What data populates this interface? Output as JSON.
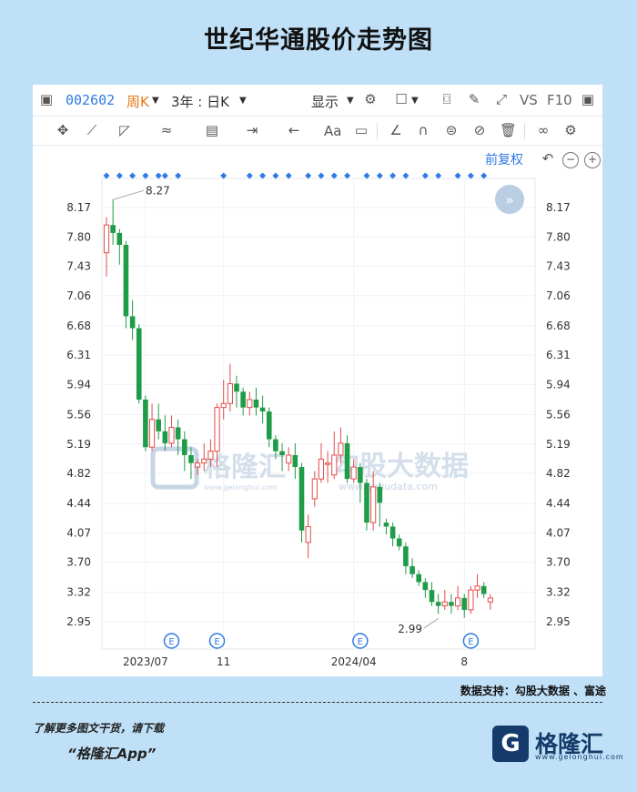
{
  "title": "世纪华通股价走势图",
  "toolbar": {
    "code": "002602",
    "period": "周K",
    "range": "3年 : 日K",
    "display": "显示",
    "vs": "VS",
    "f10": "F10",
    "text_tool": "Aa",
    "adjust": "前复权"
  },
  "credit": "数据支持：勾股大数据 、富途",
  "download_line1": "了解更多图文干货，请下载",
  "download_line2": "“格隆汇App”",
  "logo": {
    "glyph": "G",
    "name": "格隆汇",
    "url": "www.gelonghui.com"
  },
  "watermarks": {
    "left": "格隆汇",
    "left_url": "www.gelonghui.com",
    "right": "勾股大数据",
    "right_url": "www.gogudata.com"
  },
  "chart_data": {
    "type": "candlestick",
    "y_ticks": [
      "8.17",
      "7.80",
      "7.43",
      "7.06",
      "6.68",
      "6.31",
      "5.94",
      "5.56",
      "5.19",
      "4.82",
      "4.44",
      "4.07",
      "3.70",
      "3.32",
      "2.95"
    ],
    "ylim": [
      2.95,
      8.17
    ],
    "x_ticks": [
      {
        "label": "2023/07",
        "index": 6
      },
      {
        "label": "11",
        "index": 18
      },
      {
        "label": "2024/04",
        "index": 38
      },
      {
        "label": "8",
        "index": 55
      }
    ],
    "annotations": [
      {
        "text": "8.27",
        "index": 1,
        "value": 8.27
      },
      {
        "text": "2.99",
        "index": 51,
        "value": 2.99
      }
    ],
    "event_markers": [
      {
        "label": "E",
        "index": 10
      },
      {
        "label": "E",
        "index": 17
      },
      {
        "label": "E",
        "index": 39
      },
      {
        "label": "E",
        "index": 56
      }
    ],
    "dividend_markers": [
      0,
      2,
      4,
      6,
      8,
      9,
      11,
      18,
      22,
      24,
      26,
      28,
      31,
      33,
      35,
      37,
      40,
      42,
      44,
      46,
      49,
      51,
      54,
      56,
      58
    ],
    "colors": {
      "up": "#e34b4b",
      "down": "#1f9c47"
    },
    "candles": [
      [
        7.6,
        7.95,
        8.05,
        7.3
      ],
      [
        7.95,
        7.85,
        8.27,
        7.7
      ],
      [
        7.85,
        7.7,
        7.9,
        7.45
      ],
      [
        7.7,
        6.8,
        7.75,
        6.65
      ],
      [
        6.8,
        6.65,
        7.0,
        6.5
      ],
      [
        6.65,
        5.75,
        6.7,
        5.7
      ],
      [
        5.75,
        5.15,
        5.8,
        5.1
      ],
      [
        5.15,
        5.5,
        5.7,
        5.1
      ],
      [
        5.5,
        5.35,
        5.7,
        5.25
      ],
      [
        5.35,
        5.2,
        5.55,
        5.1
      ],
      [
        5.2,
        5.4,
        5.55,
        5.15
      ],
      [
        5.4,
        5.25,
        5.5,
        5.05
      ],
      [
        5.25,
        5.05,
        5.35,
        4.85
      ],
      [
        5.05,
        4.95,
        5.15,
        4.75
      ],
      [
        4.9,
        4.95,
        5.0,
        4.8
      ],
      [
        4.95,
        5.0,
        5.2,
        4.85
      ],
      [
        5.0,
        5.1,
        5.25,
        4.9
      ],
      [
        5.1,
        5.65,
        5.7,
        4.9
      ],
      [
        5.65,
        5.7,
        6.0,
        5.5
      ],
      [
        5.7,
        5.95,
        6.2,
        5.6
      ],
      [
        5.95,
        5.85,
        6.05,
        5.65
      ],
      [
        5.85,
        5.65,
        5.9,
        5.55
      ],
      [
        5.65,
        5.75,
        5.85,
        5.55
      ],
      [
        5.75,
        5.65,
        5.9,
        5.55
      ],
      [
        5.65,
        5.6,
        5.8,
        5.45
      ],
      [
        5.6,
        5.25,
        5.65,
        5.15
      ],
      [
        5.25,
        5.1,
        5.3,
        5.0
      ],
      [
        5.1,
        5.05,
        5.2,
        4.85
      ],
      [
        4.95,
        5.05,
        5.15,
        4.85
      ],
      [
        5.05,
        4.9,
        5.2,
        4.75
      ],
      [
        4.9,
        4.1,
        4.95,
        3.95
      ],
      [
        3.95,
        4.15,
        4.3,
        3.75
      ],
      [
        4.5,
        4.75,
        4.85,
        4.4
      ],
      [
        4.75,
        5.0,
        5.2,
        4.7
      ],
      [
        4.95,
        4.95,
        5.1,
        4.7
      ],
      [
        4.8,
        5.05,
        5.35,
        4.75
      ],
      [
        5.05,
        5.2,
        5.4,
        4.95
      ],
      [
        5.2,
        4.75,
        5.3,
        4.7
      ],
      [
        4.75,
        4.9,
        5.0,
        4.7
      ],
      [
        4.9,
        4.7,
        4.95,
        4.45
      ],
      [
        4.7,
        4.2,
        4.75,
        4.1
      ],
      [
        4.2,
        4.65,
        4.85,
        4.1
      ],
      [
        4.65,
        4.45,
        4.7,
        4.15
      ],
      [
        4.2,
        4.15,
        4.25,
        4.05
      ],
      [
        4.15,
        4.0,
        4.2,
        3.9
      ],
      [
        4.0,
        3.9,
        4.05,
        3.85
      ],
      [
        3.9,
        3.65,
        3.95,
        3.55
      ],
      [
        3.65,
        3.55,
        3.75,
        3.5
      ],
      [
        3.55,
        3.45,
        3.6,
        3.4
      ],
      [
        3.45,
        3.35,
        3.5,
        3.25
      ],
      [
        3.35,
        3.2,
        3.45,
        3.15
      ],
      [
        3.2,
        3.15,
        3.3,
        3.05
      ],
      [
        3.15,
        3.2,
        3.35,
        3.1
      ],
      [
        3.2,
        3.15,
        3.3,
        3.05
      ],
      [
        3.15,
        3.25,
        3.4,
        3.1
      ],
      [
        3.25,
        3.1,
        3.3,
        3.0
      ],
      [
        3.1,
        3.35,
        3.4,
        3.05
      ],
      [
        3.35,
        3.4,
        3.55,
        3.25
      ],
      [
        3.4,
        3.3,
        3.45,
        3.25
      ],
      [
        3.2,
        3.25,
        3.3,
        3.1
      ]
    ]
  }
}
